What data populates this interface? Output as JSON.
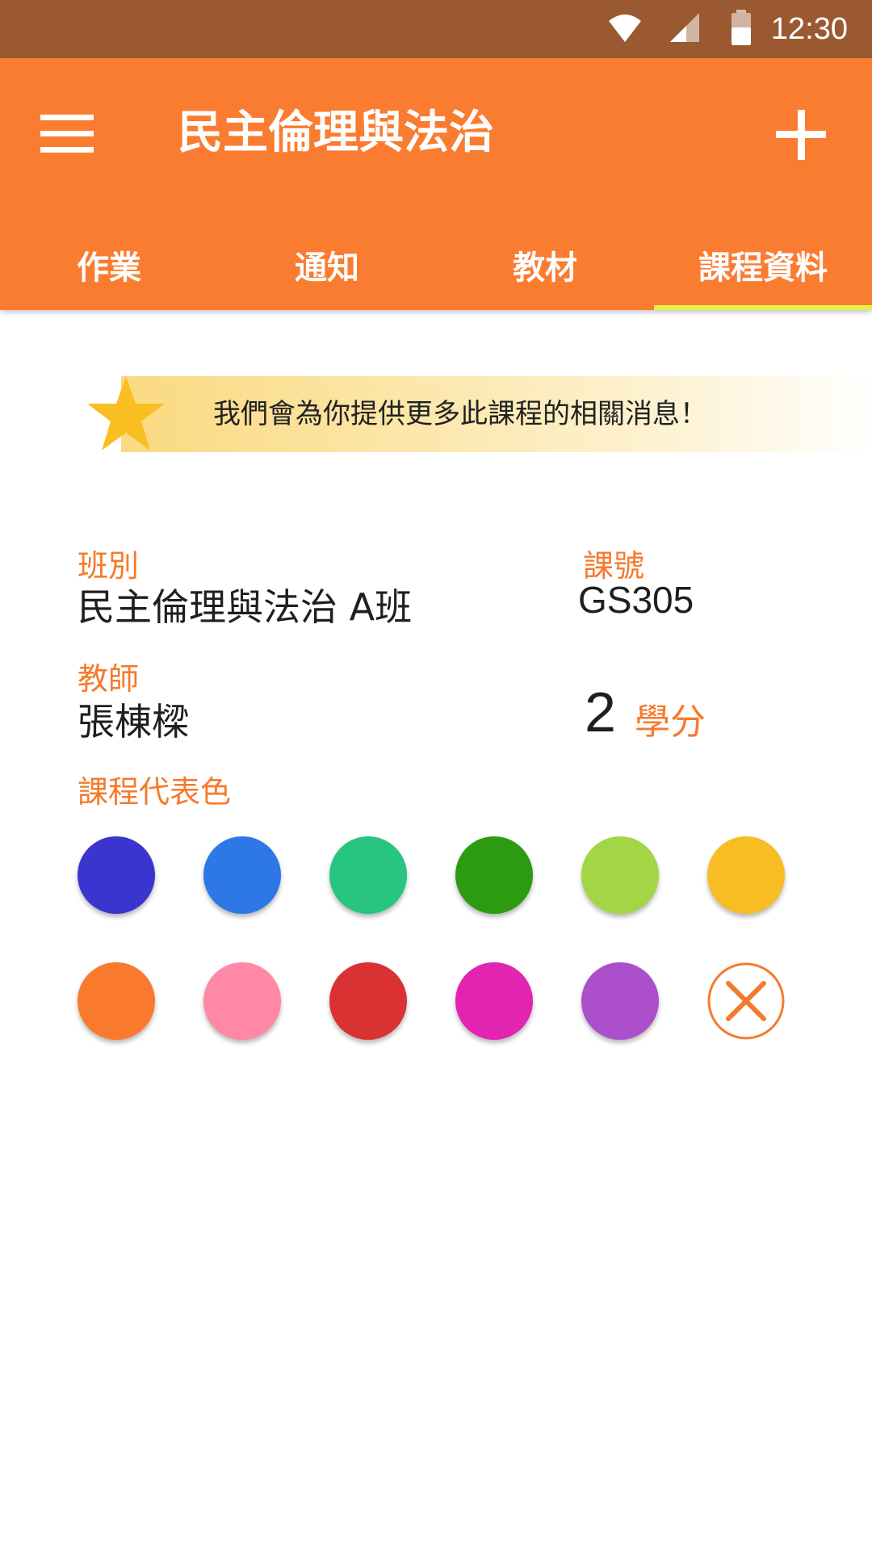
{
  "status_bar": {
    "time": "12:30",
    "icons": [
      "wifi-icon",
      "cellular-signal-icon",
      "battery-icon"
    ]
  },
  "app_bar": {
    "title": "民主倫理與法治",
    "menu_icon": "hamburger-menu-icon",
    "add_icon": "plus-icon",
    "background_color": "#fa7c31"
  },
  "tabs": [
    {
      "label": "作業",
      "selected": false
    },
    {
      "label": "通知",
      "selected": false
    },
    {
      "label": "教材",
      "selected": false
    },
    {
      "label": "課程資料",
      "selected": true
    }
  ],
  "tab_indicator_color": "#e3f24a",
  "banner": {
    "icon": "star-icon",
    "text": "我們會為你提供更多此課程的相關消息！"
  },
  "course_info": {
    "class_label": "班別",
    "class_value": "民主倫理與法治  A班",
    "code_label": "課號",
    "code_value": "GS305",
    "teacher_label": "教師",
    "teacher_value": "張棟樑",
    "credits_value": "2",
    "credits_unit": "學分",
    "color_label": "課程代表色"
  },
  "accent_color": "#f57a2c",
  "color_options": [
    {
      "name": "indigo",
      "hex": "#3b35cf"
    },
    {
      "name": "blue",
      "hex": "#2e77e6"
    },
    {
      "name": "teal-green",
      "hex": "#27c57f"
    },
    {
      "name": "green",
      "hex": "#2d9b12"
    },
    {
      "name": "lime",
      "hex": "#a2d644"
    },
    {
      "name": "amber",
      "hex": "#f8bd22"
    },
    {
      "name": "orange",
      "hex": "#f97a2d"
    },
    {
      "name": "pink",
      "hex": "#fe88a6"
    },
    {
      "name": "red",
      "hex": "#da3232"
    },
    {
      "name": "magenta",
      "hex": "#e324b0"
    },
    {
      "name": "purple",
      "hex": "#ac4fcb"
    }
  ],
  "clear_color_icon": "clear-x-circle-icon"
}
